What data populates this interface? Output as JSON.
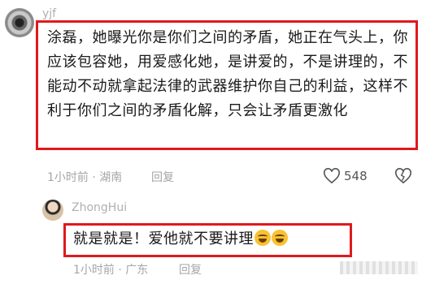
{
  "comment1": {
    "username": "yjf",
    "text": "涂磊，她曝光你是你们之间的矛盾，她正在气头上，你应该包容她，用爱感化她，是讲爱的，不是讲理的，不能动不动就拿起法律的武器维护你自己的利益，这样不利于你们之间的矛盾化解，只会让矛盾更激化",
    "meta": "1小时前 · 湖南",
    "reply_label": "回复",
    "likes": "548",
    "icons": [
      "heart-icon",
      "dislike-heart-icon"
    ]
  },
  "reply": {
    "username": "ZhongHui",
    "text": "就是就是！爱他就不要讲理",
    "emoji": [
      "laughing-crying-emoji",
      "laughing-crying-emoji"
    ],
    "meta": "1小时前 · 广东",
    "reply_label": "回复"
  },
  "colors": {
    "highlight": "#e0191d",
    "meta": "#a6a6a6"
  }
}
